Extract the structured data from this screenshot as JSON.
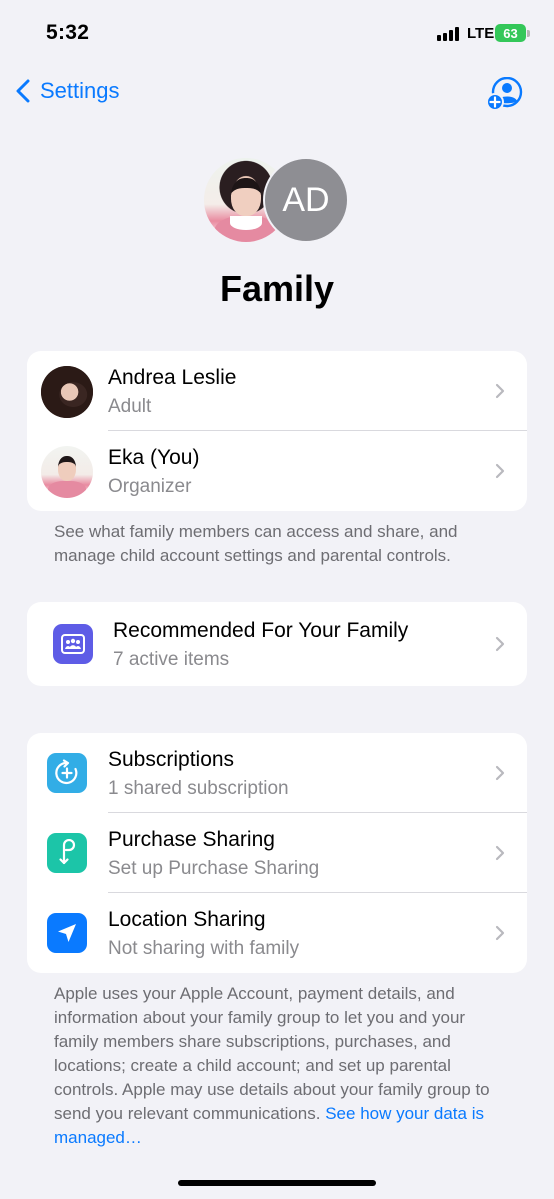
{
  "status_bar": {
    "time": "5:32",
    "network": "LTE",
    "battery": "63"
  },
  "nav": {
    "back_label": "Settings",
    "add_member_icon": "person-add-icon"
  },
  "header": {
    "avatar_initials": "AD",
    "title": "Family"
  },
  "members": [
    {
      "name": "Andrea Leslie",
      "role": "Adult"
    },
    {
      "name": "Eka (You)",
      "role": "Organizer"
    }
  ],
  "members_footnote": "See what family members can access and share, and manage child account settings and parental controls.",
  "recommended": {
    "title": "Recommended For Your Family",
    "subtitle": "7 active items",
    "icon": "family-checklist-icon"
  },
  "features": [
    {
      "title": "Subscriptions",
      "subtitle": "1 shared subscription",
      "icon": "subscriptions-icon",
      "color": "#32ade6"
    },
    {
      "title": "Purchase Sharing",
      "subtitle": "Set up Purchase Sharing",
      "icon": "purchase-sharing-icon",
      "color": "#1cc5a8"
    },
    {
      "title": "Location Sharing",
      "subtitle": "Not sharing with family",
      "icon": "location-arrow-icon",
      "color": "#0a7aff"
    }
  ],
  "privacy_footnote": {
    "text": "Apple uses your Apple Account, payment details, and information about your family group to let you and your family members share subscriptions, purchases, and locations; create a child account; and set up parental controls. Apple may use details about your family group to send you relevant communications.",
    "link": "See how your data is managed…"
  },
  "colors": {
    "accent": "#0a7aff",
    "background": "#f2f2f7",
    "recommended_icon": "#5e5ce6"
  }
}
